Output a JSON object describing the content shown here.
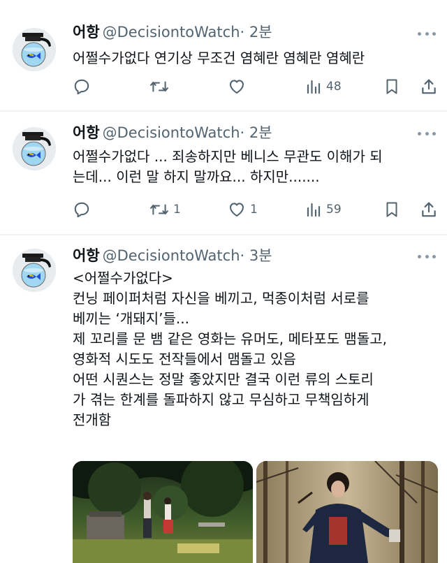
{
  "tweets": [
    {
      "name": "어항",
      "handle": "@DecisiontoWatch",
      "time": "· 2분",
      "lines": [
        "어쩔수가없다 연기상 무조건 염혜란 염혜란 염혜란"
      ],
      "replies": "",
      "retweets": "",
      "likes": "",
      "views": "48"
    },
    {
      "name": "어항",
      "handle": "@DecisiontoWatch",
      "time": "· 2분",
      "lines": [
        "어쩔수가없다 ... 죄송하지만 베니스 무관도 이해가 되",
        "는데... 이런 말 하지 말까요... 하지만......."
      ],
      "replies": "",
      "retweets": "1",
      "likes": "1",
      "views": "59"
    },
    {
      "name": "어항",
      "handle": "@DecisiontoWatch",
      "time": "· 3분",
      "lines": [
        "<어쩔수가없다>",
        "컨닝 페이퍼처럼 자신을 베끼고, 먹종이처럼 서로를",
        "베끼는 ‘개돼지’들...",
        "제 꼬리를 문 뱀 같은 영화는 유머도, 메타포도 맴돌고,",
        "영화적 시도도 전작들에서 맴돌고 있음",
        "어떤 시퀀스는 정말 좋았지만 결국 이런 류의 스토리",
        "가 겪는 한계를 돌파하지 않고 무심하고 무책임하게",
        "전개함"
      ]
    }
  ],
  "icons": {
    "avatar": "coffee-pot-fish-icon",
    "reply": "reply-icon",
    "retweet": "retweet-icon",
    "like": "heart-icon",
    "views": "views-icon",
    "bookmark": "bookmark-icon",
    "share": "share-icon",
    "more": "more-dots-icon"
  },
  "colors": {
    "text": "#0f1419",
    "secondary": "#536471",
    "divider": "#eff3f4"
  }
}
